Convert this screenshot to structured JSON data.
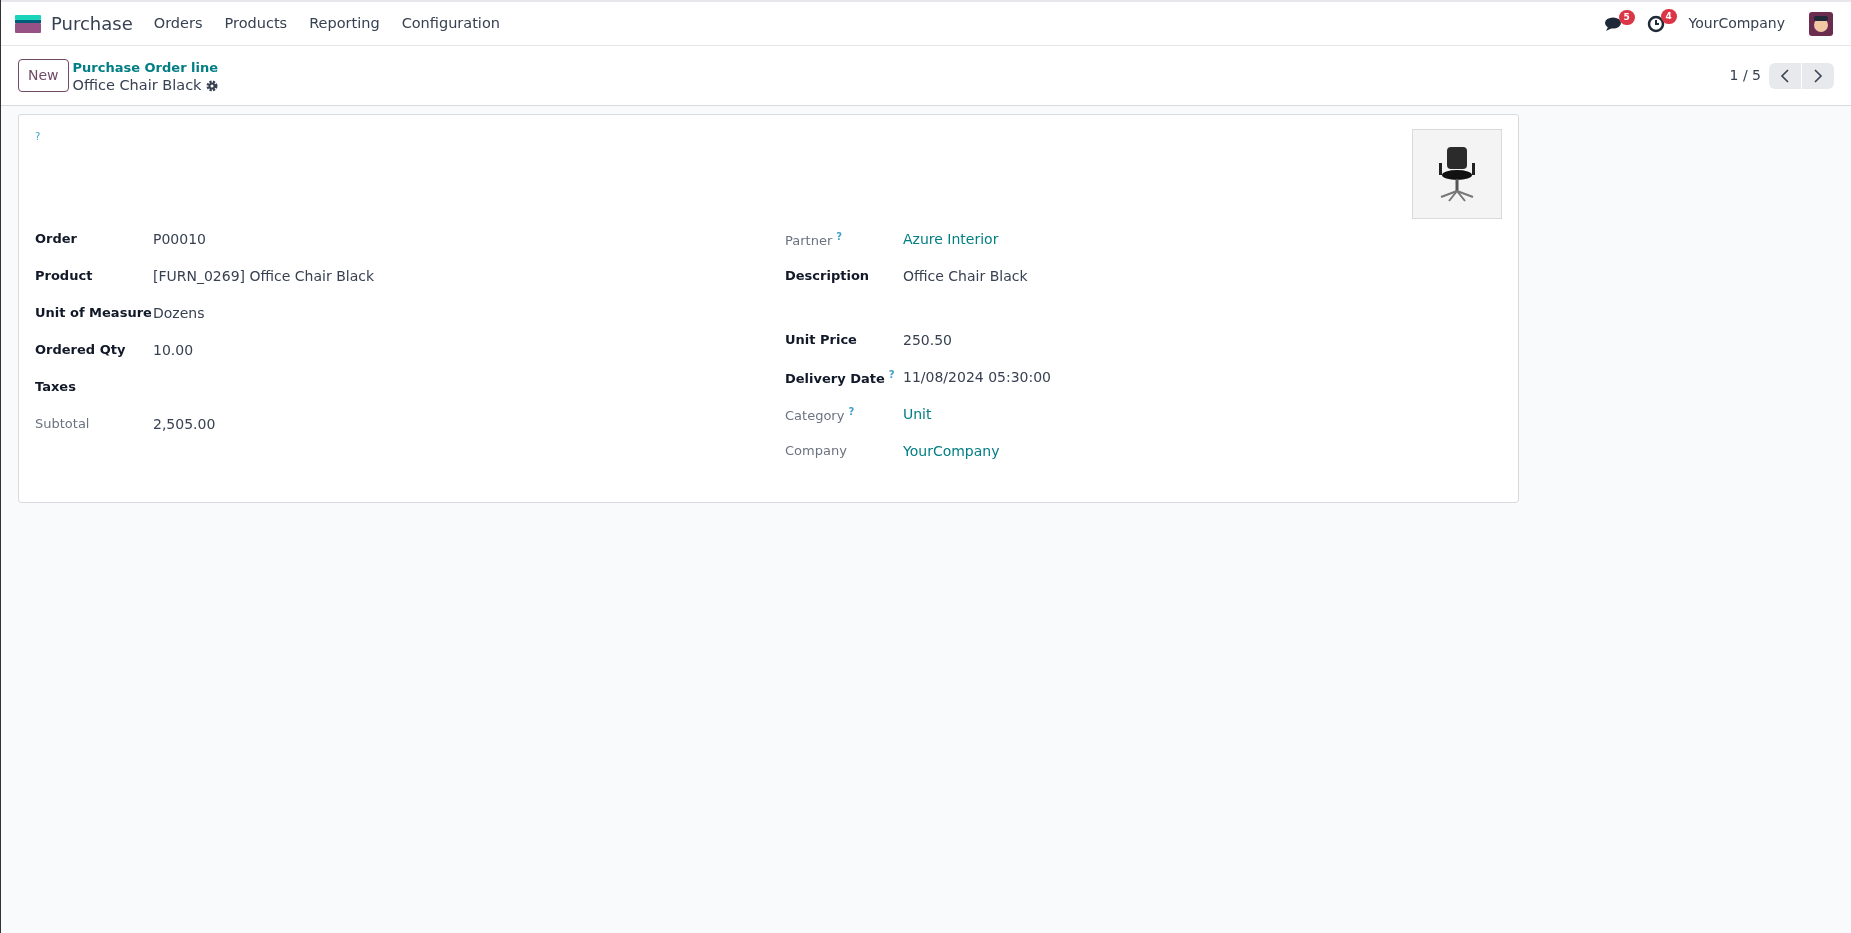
{
  "navbar": {
    "app": "Purchase",
    "menu": [
      "Orders",
      "Products",
      "Reporting",
      "Configuration"
    ],
    "messages_count": "5",
    "activities_count": "4",
    "company": "YourCompany"
  },
  "control_panel": {
    "new_button": "New",
    "breadcrumb": "Purchase Order line",
    "record_title": "Office Chair Black",
    "pager": "1 / 5"
  },
  "form": {
    "top_help": "?",
    "left_fields": [
      {
        "label": "Order",
        "value": "P00010",
        "kind": "text",
        "readonly": false
      },
      {
        "label": "Product",
        "value": "[FURN_0269] Office Chair Black",
        "kind": "text",
        "readonly": false
      },
      {
        "label": "Unit of Measure",
        "value": "Dozens",
        "kind": "text",
        "readonly": false
      },
      {
        "label": "Ordered Qty",
        "value": "10.00",
        "kind": "text",
        "readonly": false
      },
      {
        "label": "Taxes",
        "kind": "text",
        "readonly": false
      },
      {
        "label": "Subtotal",
        "value": "2,505.00",
        "kind": "text",
        "readonly": true
      }
    ],
    "right_fields": [
      {
        "label": "Partner",
        "help": "?",
        "value": "Azure Interior",
        "kind": "link",
        "readonly": true
      },
      {
        "label": "Description",
        "value": "Office Chair Black",
        "kind": "multiline",
        "readonly": false
      },
      {
        "label": "Unit Price",
        "value": "250.50",
        "kind": "text",
        "readonly": false
      },
      {
        "label": "Delivery Date",
        "help": "?",
        "value": "11/08/2024 05:30:00",
        "kind": "text",
        "readonly": false
      },
      {
        "label": "Category",
        "help": "?",
        "value": "Unit",
        "kind": "link",
        "readonly": true
      },
      {
        "label": "Company",
        "value": "YourCompany",
        "kind": "link",
        "readonly": true
      }
    ]
  }
}
